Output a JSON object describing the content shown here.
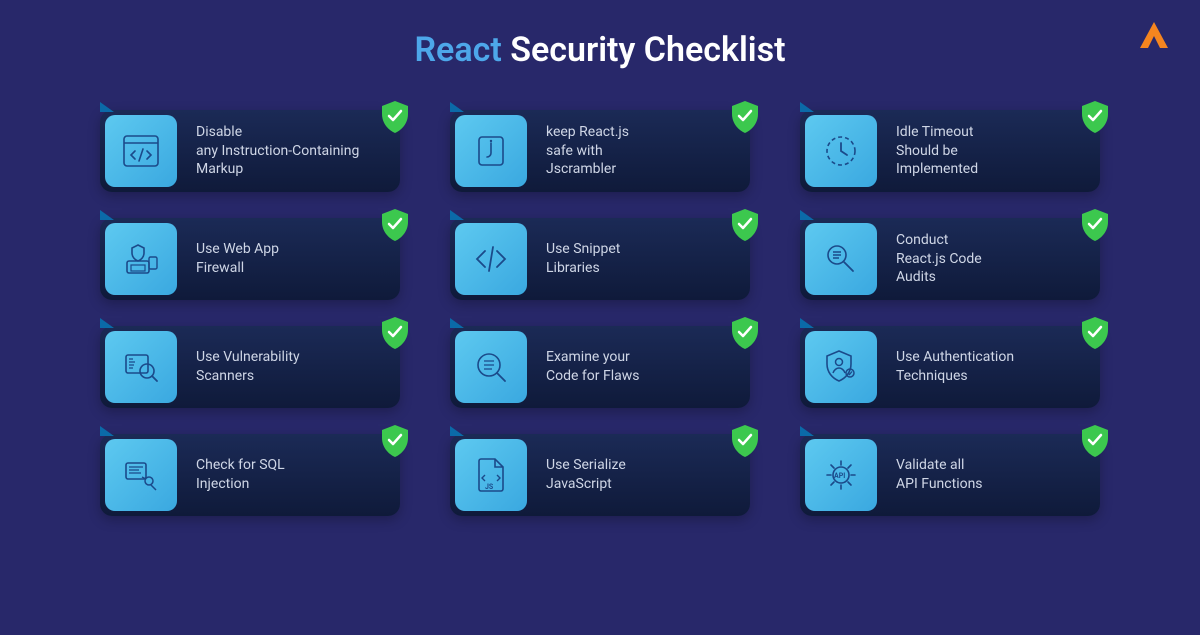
{
  "title": {
    "accent": "React",
    "rest": " Security Checklist"
  },
  "logo_icon": "logo-triangle-icon",
  "check_icon": "shield-check-icon",
  "cards": [
    {
      "icon": "code-window-icon",
      "label": "Disable\nany Instruction-Containing Markup"
    },
    {
      "icon": "jscrambler-icon",
      "label": "keep React.js\nsafe with\nJscrambler"
    },
    {
      "icon": "clock-idle-icon",
      "label": "Idle Timeout\nShould be\nImplemented"
    },
    {
      "icon": "firewall-shield-icon",
      "label": "Use Web App\nFirewall"
    },
    {
      "icon": "code-slash-icon",
      "label": "Use Snippet\nLibraries"
    },
    {
      "icon": "code-audit-icon",
      "label": "Conduct\nReact.js Code\nAudits"
    },
    {
      "icon": "scanner-icon",
      "label": "Use Vulnerability\nScanners"
    },
    {
      "icon": "magnify-doc-icon",
      "label": "Examine your\nCode for Flaws"
    },
    {
      "icon": "auth-shield-icon",
      "label": "Use Authentication\nTechniques"
    },
    {
      "icon": "sql-injection-icon",
      "label": "Check for SQL\nInjection"
    },
    {
      "icon": "js-file-icon",
      "label": "Use Serialize\nJavaScript"
    },
    {
      "icon": "api-gear-icon",
      "label": "Validate all\nAPI Functions"
    }
  ]
}
